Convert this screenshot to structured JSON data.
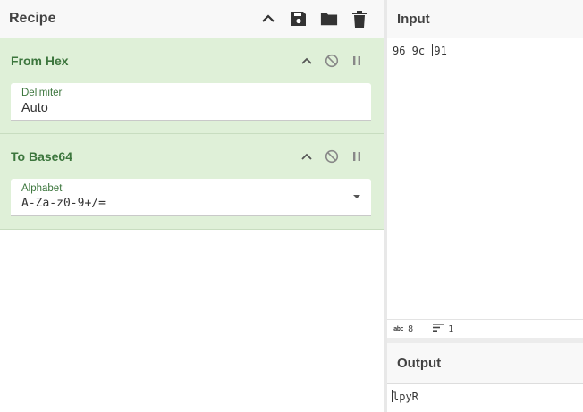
{
  "recipe": {
    "title": "Recipe",
    "icons": [
      "chevron-up-icon",
      "save-icon",
      "folder-icon",
      "trash-icon"
    ],
    "operations": [
      {
        "title": "From Hex",
        "field_label": "Delimiter",
        "field_value": "Auto",
        "has_dropdown": false
      },
      {
        "title": "To Base64",
        "field_label": "Alphabet",
        "field_value": "A-Za-z0-9+/=",
        "has_dropdown": true
      }
    ]
  },
  "input": {
    "title": "Input",
    "text_before_caret": "96 9c ",
    "text_after_caret": "91",
    "status": {
      "length_icon": "abc",
      "length": "8",
      "lines": "1"
    }
  },
  "output": {
    "title": "Output",
    "text": "lpyR"
  },
  "colors": {
    "op_background": "#dff0d8",
    "op_title": "#3c763d"
  }
}
